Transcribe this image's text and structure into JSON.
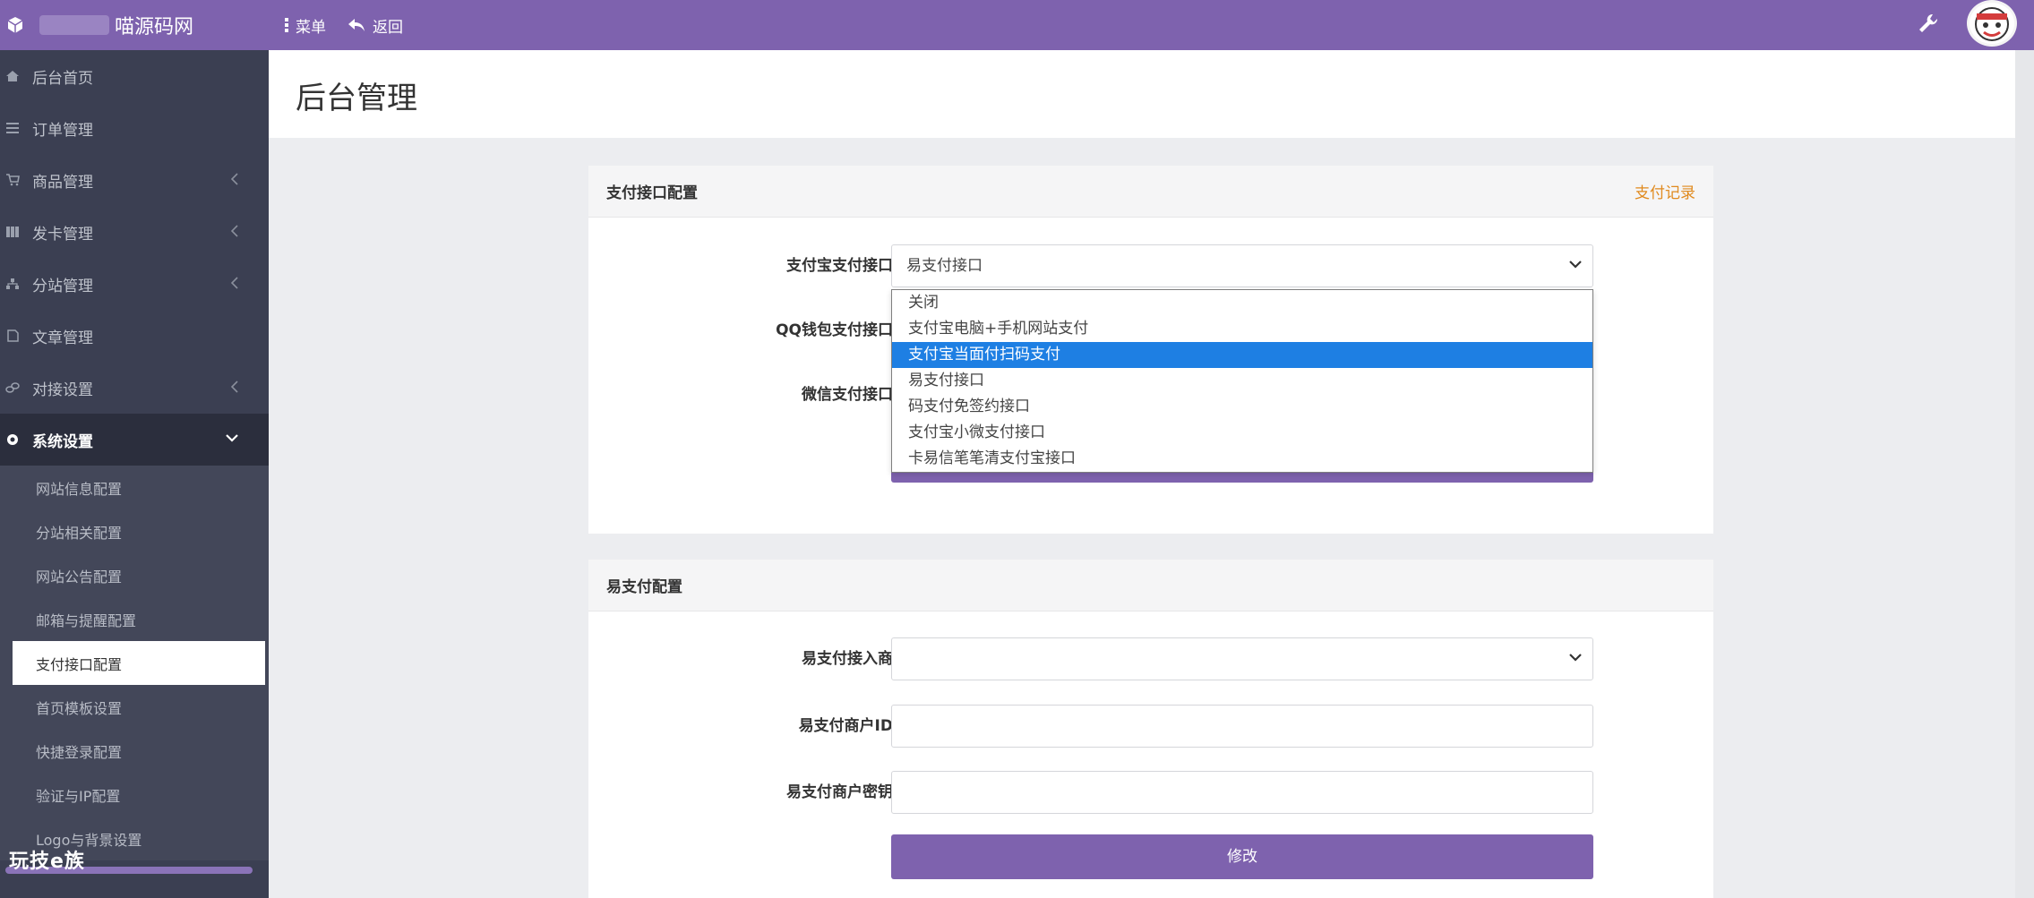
{
  "topbar": {
    "brand_name": "喵源码网",
    "menu_label": "菜单",
    "back_label": "返回",
    "accent_color": "#7e62ae"
  },
  "sidebar": {
    "items": [
      {
        "label": "后台首页",
        "icon": "home-icon"
      },
      {
        "label": "订单管理",
        "icon": "list-icon"
      },
      {
        "label": "商品管理",
        "icon": "cart-icon",
        "has_arrow": true
      },
      {
        "label": "发卡管理",
        "icon": "grid-icon",
        "has_arrow": true
      },
      {
        "label": "分站管理",
        "icon": "sitemap-icon",
        "has_arrow": true
      },
      {
        "label": "文章管理",
        "icon": "document-icon"
      },
      {
        "label": "对接设置",
        "icon": "link-icon",
        "has_arrow": true
      },
      {
        "label": "系统设置",
        "icon": "gear-icon",
        "expanded": true
      }
    ],
    "sub_items": [
      "网站信息配置",
      "分站相关配置",
      "网站公告配置",
      "邮箱与提醒配置",
      "支付接口配置",
      "首页模板设置",
      "快捷登录配置",
      "验证与IP配置",
      "Logo与背景设置"
    ],
    "current_sub": "支付接口配置",
    "watermark": "玩技e族"
  },
  "header": {
    "title": "后台管理"
  },
  "payment_card": {
    "title": "支付接口配置",
    "link": "支付记录",
    "alipay_label": "支付宝支付接口",
    "alipay_value": "易支付接口",
    "qq_label": "QQ钱包支付接口",
    "wechat_label": "微信支付接口",
    "dropdown_options": [
      "关闭",
      "支付宝电脑+手机网站支付",
      "支付宝当面付扫码支付",
      "易支付接口",
      "码支付免签约接口",
      "支付宝小微支付接口",
      "卡易信笔笔清支付宝接口"
    ],
    "highlighted_option": "支付宝当面付扫码支付"
  },
  "epay_card": {
    "title": "易支付配置",
    "provider_label": "易支付接入商",
    "provider_value": "",
    "merchant_id_label": "易支付商户ID",
    "merchant_id_value": "",
    "merchant_key_label": "易支付商户密钥",
    "merchant_key_value": "",
    "submit_label": "修改"
  }
}
